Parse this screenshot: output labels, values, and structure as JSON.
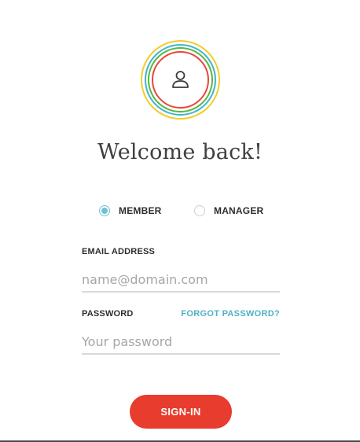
{
  "logo": {
    "icon": "user-icon",
    "ring_colors": [
      "#f2cc2c",
      "#3fb6c6",
      "#55b848",
      "#e9463a"
    ]
  },
  "header": {
    "title": "Welcome back!"
  },
  "role": {
    "options": [
      {
        "label": "MEMBER",
        "selected": true
      },
      {
        "label": "MANAGER",
        "selected": false
      }
    ]
  },
  "form": {
    "email_label": "EMAIL ADDRESS",
    "email_placeholder": "name@domain.com",
    "email_value": "",
    "password_label": "PASSWORD",
    "password_placeholder": "Your password",
    "password_value": "",
    "forgot_label": "FORGOT PASSWORD?",
    "submit_label": "SIGN-IN"
  },
  "colors": {
    "accent": "#e73c2e",
    "link": "#4fb0c6",
    "radio_checked": "#6ec3d3"
  }
}
